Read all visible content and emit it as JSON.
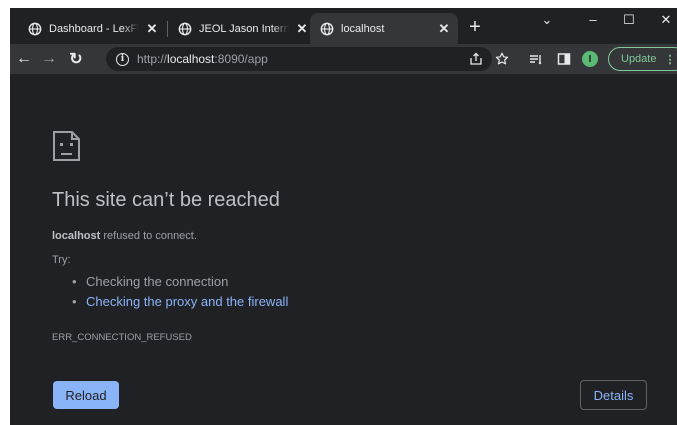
{
  "tabs": [
    {
      "title": "Dashboard - LexFlow",
      "close": "✕"
    },
    {
      "title": "JEOL Jason Internal",
      "close": "✕"
    },
    {
      "title": "localhost",
      "close": "✕"
    }
  ],
  "tabstrip": {
    "new_tab": "+",
    "tab_search": "⌄"
  },
  "window_controls": {
    "minimize": "–",
    "maximize": "☐",
    "close": "✕"
  },
  "toolbar": {
    "back": "←",
    "forward": "→",
    "reload": "↻",
    "url_scheme": "http://",
    "url_host": "localhost",
    "url_rest": ":8090/app",
    "profile_initial": "I",
    "update_label": "Update",
    "update_menu": "⋮"
  },
  "error": {
    "title": "This site can’t be reached",
    "host": "localhost",
    "message": " refused to connect.",
    "try_label": "Try:",
    "suggestions": [
      "Checking the connection",
      "Checking the proxy and the firewall"
    ],
    "code": "ERR_CONNECTION_REFUSED",
    "reload_label": "Reload",
    "details_label": "Details"
  },
  "colors": {
    "background": "#202124",
    "toolbar": "#35363a",
    "link": "#8ab4f8",
    "text": "#bdc1c6",
    "update": "#81c995"
  }
}
